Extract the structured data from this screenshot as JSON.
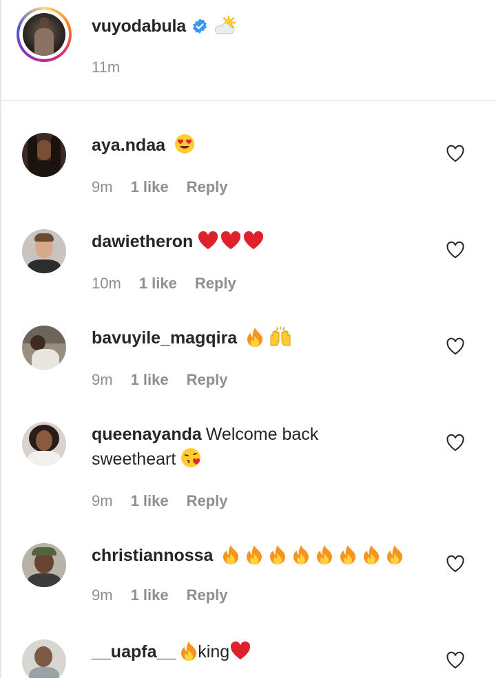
{
  "post": {
    "username": "vuyodabula",
    "time": "11m",
    "verified_icon": "verified-badge-icon",
    "emoji_icon": "sun-behind-cloud-icon"
  },
  "comments": [
    {
      "username": "aya.ndaa",
      "text": "",
      "emojis": [
        "heart-eyes-face-icon"
      ],
      "time": "9m",
      "likes": "1 like",
      "reply": "Reply"
    },
    {
      "username": "dawietheron",
      "text": "",
      "emojis": [
        "red-heart-icon",
        "red-heart-icon",
        "red-heart-icon"
      ],
      "time": "10m",
      "likes": "1 like",
      "reply": "Reply"
    },
    {
      "username": "bavuyile_magqira",
      "text": "",
      "emojis": [
        "fire-icon",
        "raising-hands-icon"
      ],
      "time": "9m",
      "likes": "1 like",
      "reply": "Reply"
    },
    {
      "username": "queenayanda",
      "text": "Welcome back sweetheart",
      "emojis": [
        "face-blowing-kiss-icon"
      ],
      "time": "9m",
      "likes": "1 like",
      "reply": "Reply"
    },
    {
      "username": "christiannossa",
      "text": "",
      "emojis": [
        "fire-icon",
        "fire-icon",
        "fire-icon",
        "fire-icon",
        "fire-icon",
        "fire-icon",
        "fire-icon",
        "fire-icon"
      ],
      "time": "9m",
      "likes": "1 like",
      "reply": "Reply"
    },
    {
      "username": "__uapfa__",
      "text": "king",
      "emojis": [
        "fire-icon",
        "red-heart-icon"
      ],
      "time": "",
      "likes": "",
      "reply": ""
    }
  ],
  "colors": {
    "text": "#262626",
    "secondary": "#8e8e8e",
    "verified": "#3897f0",
    "heart": "#ed1c24",
    "divider": "#ececec"
  }
}
